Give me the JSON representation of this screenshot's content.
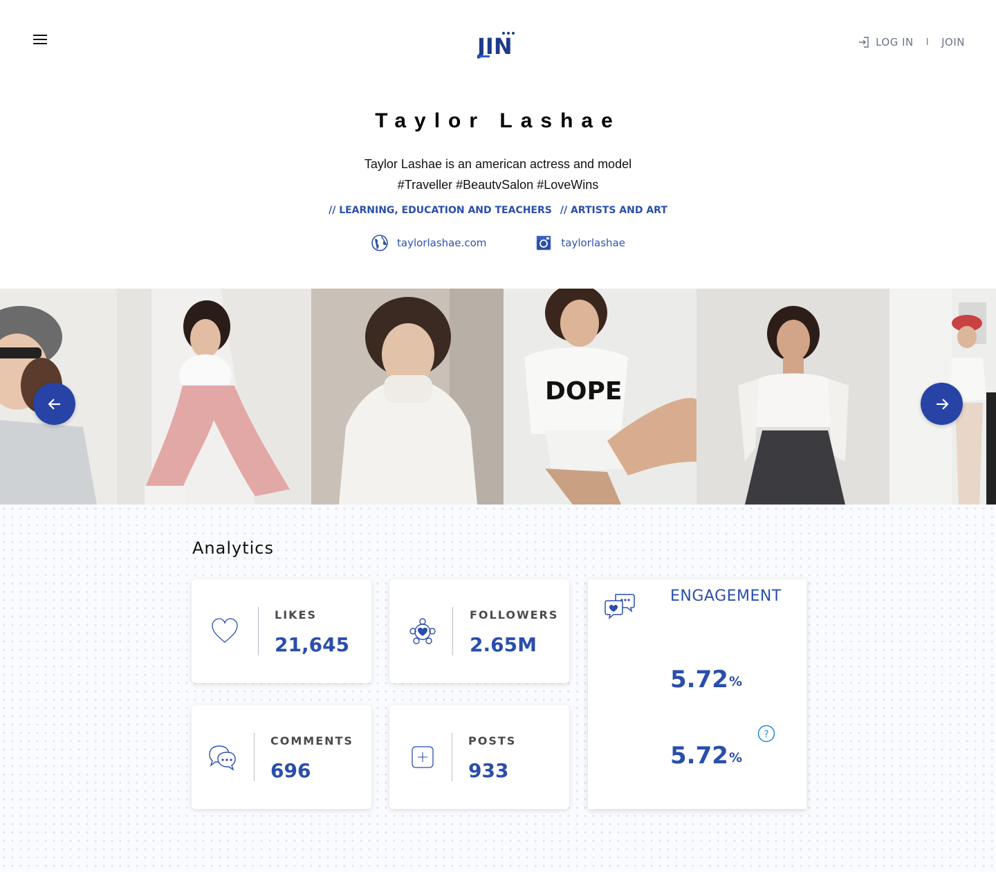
{
  "header": {
    "logo_text": "JIN",
    "login_label": "LOG IN",
    "separator": "I",
    "join_label": "JOIN"
  },
  "profile": {
    "name": "Taylor Lashae",
    "bio_line1": "Taylor Lashae is an american actress and model",
    "bio_line2": "#Traveller #BeautvSalon #LoveWins",
    "categories": [
      "// LEARNING, EDUCATION AND TEACHERS",
      "// ARTISTS AND ART"
    ],
    "website": "taylorlashae.com",
    "instagram": "taylorlashae"
  },
  "gallery": {
    "photos": [
      "photo-grey-beret",
      "photo-pink-overalls",
      "photo-white-turtleneck",
      "photo-dope-tshirt",
      "photo-offshoulder-top",
      "photo-red-beret"
    ]
  },
  "analytics": {
    "title": "Analytics",
    "likes": {
      "label": "LIKES",
      "value": "21,645"
    },
    "followers": {
      "label": "FOLLOWERS",
      "value": "2.65M"
    },
    "comments": {
      "label": "COMMENTS",
      "value": "696"
    },
    "posts": {
      "label": "POSTS",
      "value": "933"
    },
    "engagement": {
      "title": "ENGAGEMENT",
      "value1": "5.72",
      "value2": "5.72",
      "unit": "%"
    }
  },
  "colors": {
    "accent": "#2a4eaa",
    "arrow_bg": "#2743a6"
  }
}
